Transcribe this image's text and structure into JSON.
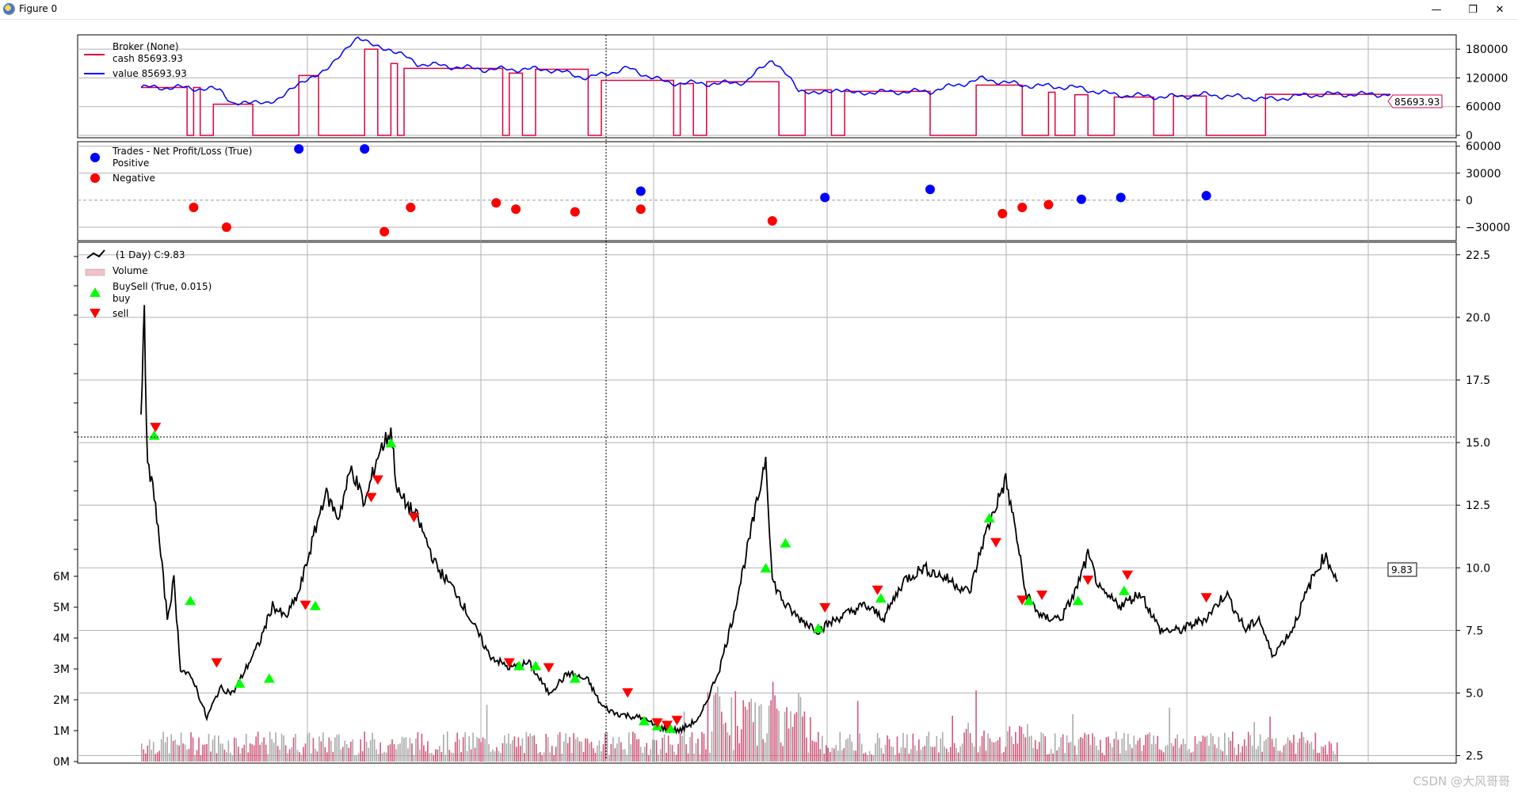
{
  "window": {
    "title": "Figure 0",
    "buttons": {
      "minimize": "—",
      "maximize": "❐",
      "close": "✕"
    }
  },
  "watermark": "CSDN @大风哥哥",
  "colors": {
    "cash": "#e0003c",
    "value": "#0000ff",
    "positive": "#0000ff",
    "negative": "#ff0000",
    "price": "#000000",
    "volume": "#d0587a",
    "buy": "#00ff00",
    "sell": "#ff0000"
  },
  "chart_data": [
    {
      "type": "line",
      "panel": "broker",
      "legend_title": "Broker (None)",
      "series": [
        {
          "name": "cash 85693.93",
          "color": "#e0003c"
        },
        {
          "name": "value 85693.93",
          "color": "#0000ff"
        }
      ],
      "yticks": [
        "0",
        "60000",
        "120000",
        "180000"
      ],
      "ylim": [
        -5000,
        210000
      ],
      "last_value_label": "85693.93",
      "value_points": [
        [
          0,
          100000
        ],
        [
          60,
          100000
        ],
        [
          120,
          95000
        ],
        [
          140,
          68000
        ],
        [
          190,
          65000
        ],
        [
          230,
          95000
        ],
        [
          280,
          140000
        ],
        [
          330,
          200000
        ],
        [
          380,
          180000
        ],
        [
          420,
          150000
        ],
        [
          520,
          138000
        ],
        [
          620,
          138000
        ],
        [
          680,
          120000
        ],
        [
          740,
          140000
        ],
        [
          800,
          110000
        ],
        [
          880,
          108000
        ],
        [
          920,
          112000
        ],
        [
          960,
          160000
        ],
        [
          1000,
          95000
        ],
        [
          1050,
          90000
        ],
        [
          1100,
          90000
        ],
        [
          1200,
          92000
        ],
        [
          1280,
          118000
        ],
        [
          1340,
          105000
        ],
        [
          1420,
          100000
        ],
        [
          1480,
          85000
        ],
        [
          1560,
          80000
        ],
        [
          1620,
          85000
        ],
        [
          1720,
          75000
        ],
        [
          1760,
          82000
        ],
        [
          1800,
          86000
        ],
        [
          1900,
          85693
        ]
      ],
      "cash_steps": [
        [
          0,
          100000
        ],
        [
          60,
          100000
        ],
        [
          70,
          0
        ],
        [
          80,
          100000
        ],
        [
          90,
          0
        ],
        [
          110,
          65000
        ],
        [
          170,
          0
        ],
        [
          240,
          125000
        ],
        [
          270,
          0
        ],
        [
          340,
          180000
        ],
        [
          360,
          0
        ],
        [
          380,
          150000
        ],
        [
          390,
          0
        ],
        [
          400,
          140000
        ],
        [
          540,
          140000
        ],
        [
          550,
          0
        ],
        [
          560,
          130000
        ],
        [
          580,
          0
        ],
        [
          600,
          138000
        ],
        [
          680,
          0
        ],
        [
          700,
          115000
        ],
        [
          790,
          115000
        ],
        [
          810,
          0
        ],
        [
          820,
          108000
        ],
        [
          840,
          0
        ],
        [
          860,
          112000
        ],
        [
          960,
          112000
        ],
        [
          970,
          0
        ],
        [
          1010,
          95000
        ],
        [
          1050,
          0
        ],
        [
          1070,
          92000
        ],
        [
          1190,
          92000
        ],
        [
          1200,
          0
        ],
        [
          1270,
          105000
        ],
        [
          1330,
          105000
        ],
        [
          1340,
          0
        ],
        [
          1380,
          90000
        ],
        [
          1390,
          0
        ],
        [
          1420,
          85000
        ],
        [
          1440,
          0
        ],
        [
          1480,
          80000
        ],
        [
          1530,
          80000
        ],
        [
          1540,
          0
        ],
        [
          1570,
          82000
        ],
        [
          1610,
          82000
        ],
        [
          1620,
          0
        ],
        [
          1700,
          0
        ],
        [
          1710,
          85693
        ],
        [
          1900,
          85693
        ]
      ]
    },
    {
      "type": "scatter",
      "panel": "trades",
      "legend_title": "Trades - Net Profit/Loss (True)",
      "series": [
        {
          "name": "Positive",
          "color": "#0000ff",
          "points": [
            [
              240,
              57000
            ],
            [
              340,
              57000
            ],
            [
              760,
              10000
            ],
            [
              1040,
              3000
            ],
            [
              1200,
              12000
            ],
            [
              1430,
              1000
            ],
            [
              1490,
              3000
            ],
            [
              1620,
              5000
            ]
          ]
        },
        {
          "name": "Negative",
          "color": "#ff0000",
          "points": [
            [
              80,
              -8000
            ],
            [
              130,
              -30000
            ],
            [
              370,
              -35000
            ],
            [
              410,
              -8000
            ],
            [
              540,
              -3000
            ],
            [
              570,
              -10000
            ],
            [
              660,
              -13000
            ],
            [
              760,
              -10000
            ],
            [
              960,
              -23000
            ],
            [
              1310,
              -15000
            ],
            [
              1340,
              -8000
            ],
            [
              1380,
              -5000
            ]
          ]
        }
      ],
      "yticks": [
        "−30000",
        "0",
        "30000",
        "60000"
      ],
      "ylim": [
        -45000,
        65000
      ]
    },
    {
      "type": "line",
      "panel": "price",
      "legend": [
        "(1 Day) C:9.83",
        "Volume",
        "BuySell (True, 0.015)",
        "buy",
        "sell"
      ],
      "yticks_right": [
        "2.5",
        "5.0",
        "7.5",
        "10.0",
        "12.5",
        "15.0",
        "17.5",
        "20.0",
        "22.5"
      ],
      "yticks_left": [
        "0M",
        "1M",
        "2M",
        "3M",
        "4M",
        "5M",
        "6M"
      ],
      "ylim": [
        2.2,
        23
      ],
      "last_price_label": "9.83",
      "price_points": [
        [
          0,
          16.5
        ],
        [
          5,
          20
        ],
        [
          10,
          14
        ],
        [
          20,
          13
        ],
        [
          30,
          10.5
        ],
        [
          40,
          8
        ],
        [
          50,
          9.5
        ],
        [
          60,
          6
        ],
        [
          80,
          5.5
        ],
        [
          100,
          4
        ],
        [
          120,
          5.2
        ],
        [
          140,
          5
        ],
        [
          160,
          6
        ],
        [
          180,
          7
        ],
        [
          200,
          8.5
        ],
        [
          220,
          8
        ],
        [
          240,
          9
        ],
        [
          260,
          11
        ],
        [
          280,
          13
        ],
        [
          300,
          12
        ],
        [
          320,
          14
        ],
        [
          340,
          12.5
        ],
        [
          360,
          14.5
        ],
        [
          380,
          15.5
        ],
        [
          390,
          13
        ],
        [
          420,
          12
        ],
        [
          450,
          10
        ],
        [
          480,
          9
        ],
        [
          500,
          8
        ],
        [
          530,
          6.5
        ],
        [
          560,
          6
        ],
        [
          590,
          6.2
        ],
        [
          620,
          5
        ],
        [
          650,
          5.8
        ],
        [
          680,
          5.5
        ],
        [
          700,
          4.5
        ],
        [
          720,
          4.2
        ],
        [
          760,
          4
        ],
        [
          790,
          3.6
        ],
        [
          820,
          3.5
        ],
        [
          850,
          4
        ],
        [
          880,
          6
        ],
        [
          900,
          8
        ],
        [
          920,
          10.5
        ],
        [
          940,
          13
        ],
        [
          950,
          14.5
        ],
        [
          960,
          9.5
        ],
        [
          980,
          8.5
        ],
        [
          1000,
          8
        ],
        [
          1030,
          7.5
        ],
        [
          1060,
          8
        ],
        [
          1100,
          8.5
        ],
        [
          1130,
          8
        ],
        [
          1160,
          9.5
        ],
        [
          1190,
          10
        ],
        [
          1230,
          9.5
        ],
        [
          1260,
          9
        ],
        [
          1280,
          11
        ],
        [
          1300,
          12.5
        ],
        [
          1315,
          13.5
        ],
        [
          1330,
          11.5
        ],
        [
          1345,
          9
        ],
        [
          1370,
          8
        ],
        [
          1400,
          8
        ],
        [
          1420,
          9
        ],
        [
          1440,
          10.5
        ],
        [
          1460,
          9
        ],
        [
          1490,
          8.5
        ],
        [
          1520,
          9
        ],
        [
          1550,
          7.5
        ],
        [
          1580,
          7.5
        ],
        [
          1620,
          8
        ],
        [
          1650,
          9
        ],
        [
          1680,
          7.5
        ],
        [
          1700,
          8
        ],
        [
          1720,
          6.5
        ],
        [
          1750,
          7.5
        ],
        [
          1780,
          9.5
        ],
        [
          1800,
          10.5
        ],
        [
          1820,
          9.5
        ]
      ],
      "buy_markers": [
        [
          20,
          15.3
        ],
        [
          75,
          8.7
        ],
        [
          150,
          5.4
        ],
        [
          195,
          5.6
        ],
        [
          265,
          8.5
        ],
        [
          380,
          15
        ],
        [
          575,
          6.1
        ],
        [
          600,
          6.1
        ],
        [
          660,
          5.6
        ],
        [
          765,
          3.9
        ],
        [
          785,
          3.7
        ],
        [
          805,
          3.6
        ],
        [
          950,
          10
        ],
        [
          980,
          11
        ],
        [
          1030,
          7.6
        ],
        [
          1125,
          8.8
        ],
        [
          1290,
          12
        ],
        [
          1350,
          8.7
        ],
        [
          1425,
          8.7
        ],
        [
          1495,
          9.1
        ]
      ],
      "sell_markers": [
        [
          22,
          15.6
        ],
        [
          115,
          6.2
        ],
        [
          250,
          8.5
        ],
        [
          350,
          12.8
        ],
        [
          360,
          13.5
        ],
        [
          415,
          12
        ],
        [
          560,
          6.2
        ],
        [
          620,
          6
        ],
        [
          740,
          5
        ],
        [
          785,
          3.8
        ],
        [
          800,
          3.7
        ],
        [
          815,
          3.9
        ],
        [
          1040,
          8.4
        ],
        [
          1120,
          9.1
        ],
        [
          1300,
          11
        ],
        [
          1340,
          8.7
        ],
        [
          1370,
          8.9
        ],
        [
          1440,
          9.5
        ],
        [
          1500,
          9.7
        ],
        [
          1620,
          8.8
        ]
      ]
    }
  ]
}
